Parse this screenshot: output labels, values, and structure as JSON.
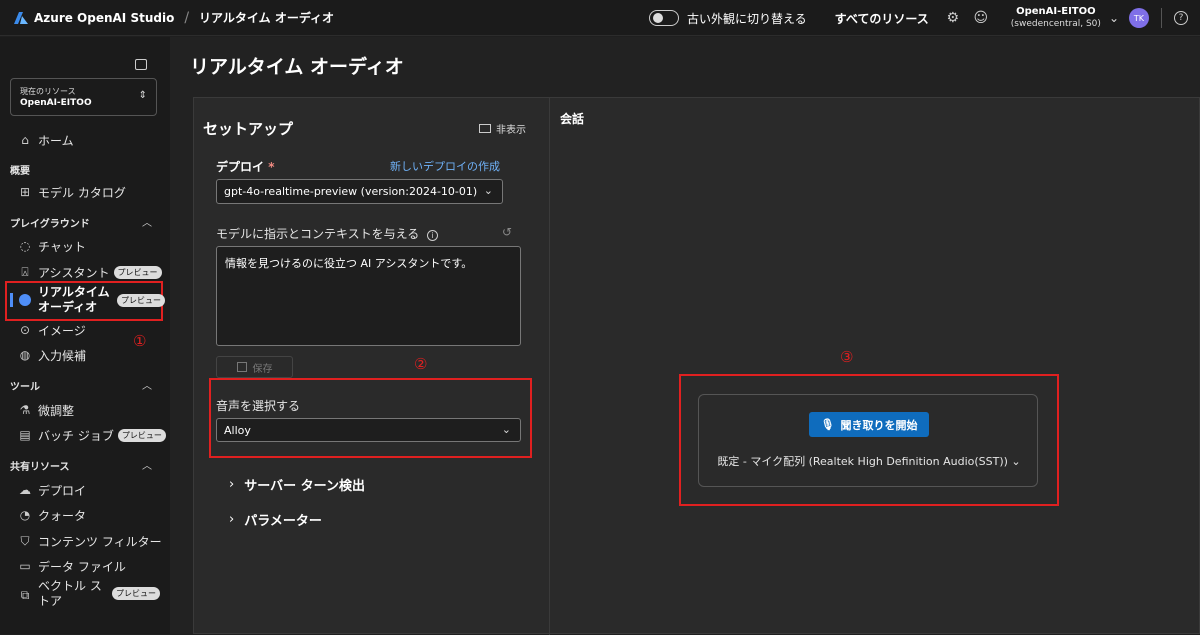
{
  "app": {
    "brand": "Azure OpenAI Studio",
    "breadcrumb": "リアルタイム オーディオ"
  },
  "topbar": {
    "toggle_label": "古い外観に切り替える",
    "all_resources": "すべてのリソース",
    "account_name": "OpenAI-EITOO",
    "account_region": "(swedencentral, S0)",
    "avatar_initials": "TK",
    "help": "?"
  },
  "sidebar": {
    "resource_label": "現在のリソース",
    "resource_value": "OpenAI-EITOO",
    "home": "ホーム",
    "section_overview": "概要",
    "model_catalog": "モデル カタログ",
    "section_playground": "プレイグラウンド",
    "chat": "チャット",
    "assistant": "アシスタント",
    "realtime_audio": "リアルタイム オーディオ",
    "image": "イメージ",
    "completion": "入力候補",
    "section_tools": "ツール",
    "finetune": "微調整",
    "batch_job": "バッチ ジョブ",
    "section_shared": "共有リソース",
    "deploy": "デプロイ",
    "quota": "クォータ",
    "content_filter": "コンテンツ フィルター",
    "data_file": "データ ファイル",
    "vector_store": "ベクトル ストア",
    "preview_badge": "プレビュー"
  },
  "annotations": {
    "n1": "①",
    "n2": "②",
    "n3": "③"
  },
  "main": {
    "page_title": "リアルタイム オーディオ",
    "setup": {
      "title": "セットアップ",
      "hide": "非表示",
      "deploy_label": "デプロイ",
      "required_mark": "*",
      "new_deploy_link": "新しいデプロイの作成",
      "deploy_value": "gpt-4o-realtime-preview (version:2024-10-01)",
      "instruction_label": "モデルに指示とコンテキストを与える",
      "instruction_value": "情報を見つけるのに役立つ AI アシスタントです。",
      "save": "保存",
      "voice_label": "音声を選択する",
      "voice_value": "Alloy",
      "server_turn": "サーバー ターン検出",
      "parameters": "パラメーター"
    },
    "conversation": {
      "title": "会話",
      "listen_button": "聞き取りを開始",
      "mic_select": "既定 - マイク配列 (Realtek High Definition Audio(SST))"
    }
  }
}
